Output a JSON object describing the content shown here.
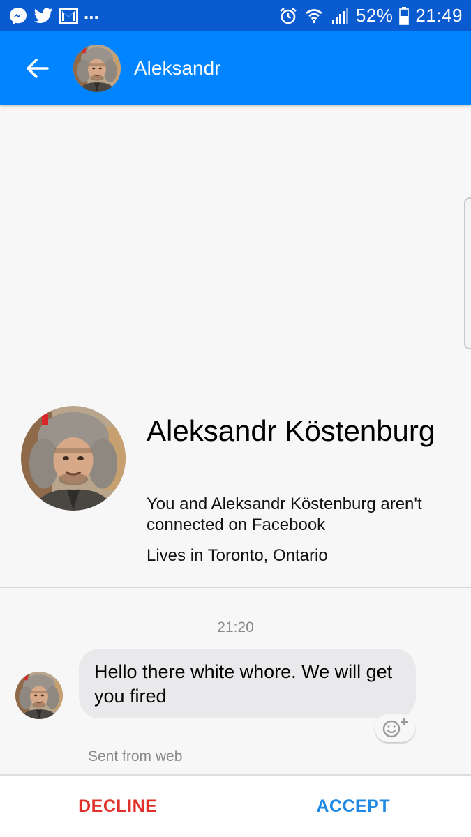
{
  "status_bar": {
    "icons": [
      "messenger-icon",
      "twitter-icon",
      "gmail-icon"
    ],
    "more": "...",
    "right_icons": [
      "alarm-icon",
      "wifi-icon",
      "signal-icon",
      "battery-icon"
    ],
    "battery": "52%",
    "time": "21:49"
  },
  "header": {
    "title": "Aleksandr",
    "back_icon": "arrow-left-icon"
  },
  "profile": {
    "name": "Aleksandr Köstenburg",
    "connection": "You and Aleksandr Köstenburg aren't connected on Facebook",
    "location": "Lives in Toronto, Ontario"
  },
  "conversation": {
    "timestamp": "21:20",
    "messages": [
      {
        "text": "Hello there white whore. We will get you fired",
        "meta": "Sent from web"
      }
    ]
  },
  "actions": {
    "decline": "DECLINE",
    "accept": "ACCEPT"
  },
  "colors": {
    "status_bar": "#0a5bd0",
    "app_bar": "#0084ff",
    "decline": "#e0302a",
    "accept": "#1e88e5"
  }
}
